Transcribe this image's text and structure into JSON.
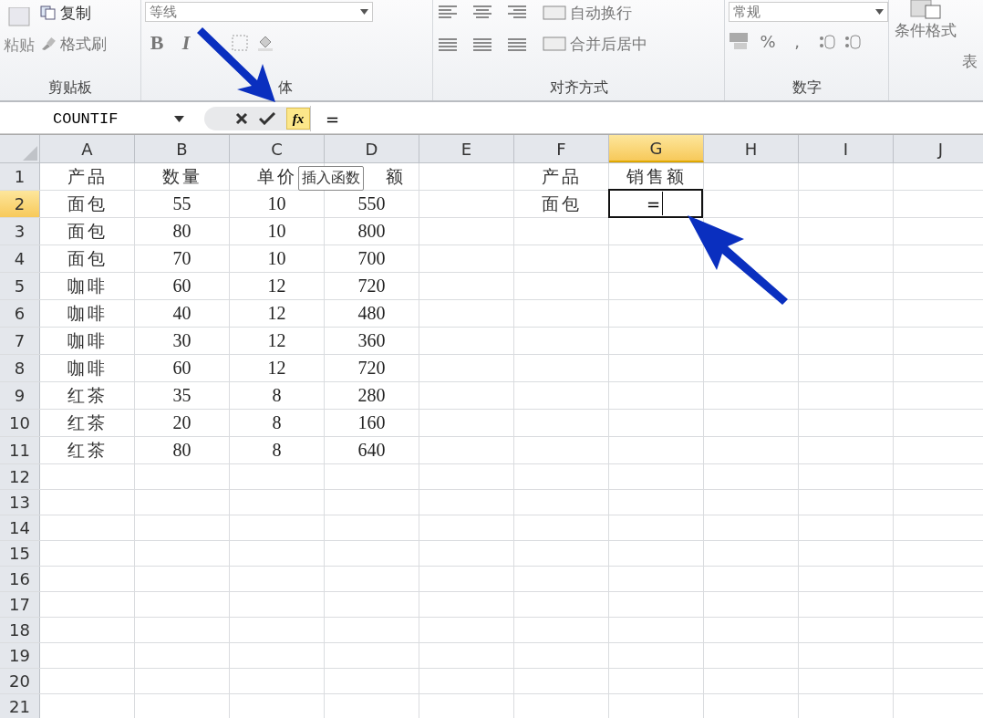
{
  "ribbon": {
    "groups": [
      {
        "kind": "clipboard",
        "label": "剪贴板",
        "paste": "粘贴",
        "items": [
          "复制",
          "格式刷"
        ]
      },
      {
        "kind": "font",
        "label": "体",
        "font_name": "等线",
        "style_buttons": [
          "B",
          "I"
        ]
      },
      {
        "kind": "alignment",
        "label": "对齐方式",
        "items": [
          "自动换行",
          "合并后居中"
        ]
      },
      {
        "kind": "number",
        "label": "数字",
        "format": "常规",
        "symbols": [
          "%",
          ","
        ]
      },
      {
        "kind": "styles",
        "items": [
          "条件格式",
          "表"
        ]
      }
    ]
  },
  "formula_bar": {
    "name_box": "COUNTIF",
    "fx": "fx",
    "formula": "="
  },
  "tooltip": "插入函数",
  "columns": [
    {
      "label": "A",
      "selected": false
    },
    {
      "label": "B",
      "selected": false
    },
    {
      "label": "C",
      "selected": false
    },
    {
      "label": "D",
      "selected": false
    },
    {
      "label": "E",
      "selected": false
    },
    {
      "label": "F",
      "selected": false
    },
    {
      "label": "G",
      "selected": true
    },
    {
      "label": "H",
      "selected": false
    },
    {
      "label": "I",
      "selected": false
    },
    {
      "label": "J",
      "selected": false
    }
  ],
  "rows": [
    {
      "label": "1",
      "selected": false,
      "cells": {
        "A": "产品",
        "B": "数量",
        "C": "单价",
        "D": "额",
        "F": "产品",
        "G": "销售额"
      }
    },
    {
      "label": "2",
      "selected": true,
      "cells": {
        "A": "面包",
        "B": "55",
        "C": "10",
        "D": "550",
        "F": "面包",
        "G": "="
      }
    },
    {
      "label": "3",
      "selected": false,
      "cells": {
        "A": "面包",
        "B": "80",
        "C": "10",
        "D": "800"
      }
    },
    {
      "label": "4",
      "selected": false,
      "cells": {
        "A": "面包",
        "B": "70",
        "C": "10",
        "D": "700"
      }
    },
    {
      "label": "5",
      "selected": false,
      "cells": {
        "A": "咖啡",
        "B": "60",
        "C": "12",
        "D": "720"
      }
    },
    {
      "label": "6",
      "selected": false,
      "cells": {
        "A": "咖啡",
        "B": "40",
        "C": "12",
        "D": "480"
      }
    },
    {
      "label": "7",
      "selected": false,
      "cells": {
        "A": "咖啡",
        "B": "30",
        "C": "12",
        "D": "360"
      }
    },
    {
      "label": "8",
      "selected": false,
      "cells": {
        "A": "咖啡",
        "B": "60",
        "C": "12",
        "D": "720"
      }
    },
    {
      "label": "9",
      "selected": false,
      "cells": {
        "A": "红茶",
        "B": "35",
        "C": "8",
        "D": "280"
      }
    },
    {
      "label": "10",
      "selected": false,
      "cells": {
        "A": "红茶",
        "B": "20",
        "C": "8",
        "D": "160"
      }
    },
    {
      "label": "11",
      "selected": false,
      "cells": {
        "A": "红茶",
        "B": "80",
        "C": "8",
        "D": "640"
      }
    },
    {
      "label": "12",
      "selected": false
    },
    {
      "label": "13",
      "selected": false
    },
    {
      "label": "14",
      "selected": false
    },
    {
      "label": "15",
      "selected": false
    },
    {
      "label": "16",
      "selected": false
    },
    {
      "label": "17",
      "selected": false
    },
    {
      "label": "18",
      "selected": false
    },
    {
      "label": "19",
      "selected": false
    },
    {
      "label": "20",
      "selected": false
    },
    {
      "label": "21",
      "selected": false
    }
  ]
}
